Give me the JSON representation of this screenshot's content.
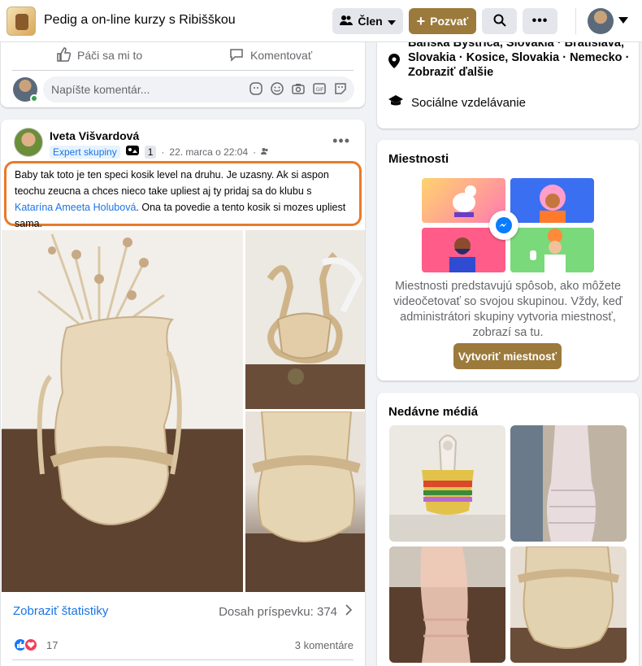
{
  "header": {
    "group_name": "Pedig a on-line kurzy s Ribišškou",
    "member_label": "Člen",
    "invite_label": "Pozvať"
  },
  "top_card": {
    "like_label": "Páči sa mi to",
    "comment_label": "Komentovať",
    "comment_placeholder": "Napíšte komentár..."
  },
  "post": {
    "author": "Iveta Višvardová",
    "badge": "Expert skupiny",
    "badge_count": "1",
    "date": "22. marca o 22:04",
    "text_1": "Baby tak toto je ten speci kosik level na druhu. Je uzasny. Ak si aspon teochu zeucna a chces nieco take upliest aj ty pridaj sa do klubu s ",
    "mention": "Katarína Ameeta Holubová",
    "text_2": ". Ona ta povedie a tento kosik si mozes upliest sama.",
    "stats_link": "Zobraziť štatistiky",
    "reach": "Dosah príspevku: 374",
    "reactions_count": "17",
    "comments_count": "3 komentáre"
  },
  "about": {
    "locations": "Banská Bystrica, Slovakia · Bratislava, Slovakia · Kosice, Slovakia · Nemecko · Zobraziť ďalšie",
    "category": "Sociálne vzdelávanie"
  },
  "rooms": {
    "title": "Miestnosti",
    "description": "Miestnosti predstavujú spôsob, ako môžete videočetovať so svojou skupinou. Vždy, keď administrátori skupiny vytvoria miestnosť, zobrazí sa tu.",
    "button": "Vytvoriť miestnosť"
  },
  "media": {
    "title": "Nedávne médiá"
  },
  "colors": {
    "accent": "#9c7a3c",
    "link": "#1b74e4",
    "highlight_outline": "#e87a2a"
  }
}
